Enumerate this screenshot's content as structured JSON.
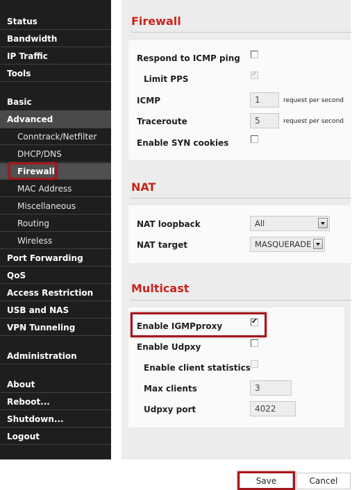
{
  "sidebar": {
    "items": [
      {
        "label": "Status"
      },
      {
        "label": "Bandwidth"
      },
      {
        "label": "IP Traffic"
      },
      {
        "label": "Tools"
      },
      {
        "label": "Basic"
      },
      {
        "label": "Advanced"
      },
      {
        "label": "Conntrack/Netfilter"
      },
      {
        "label": "DHCP/DNS"
      },
      {
        "label": "Firewall"
      },
      {
        "label": "MAC Address"
      },
      {
        "label": "Miscellaneous"
      },
      {
        "label": "Routing"
      },
      {
        "label": "Wireless"
      },
      {
        "label": "Port Forwarding"
      },
      {
        "label": "QoS"
      },
      {
        "label": "Access Restriction"
      },
      {
        "label": "USB and NAS"
      },
      {
        "label": "VPN Tunneling"
      },
      {
        "label": "Administration"
      },
      {
        "label": "About"
      },
      {
        "label": "Reboot..."
      },
      {
        "label": "Shutdown..."
      },
      {
        "label": "Logout"
      }
    ],
    "active_group": "Advanced",
    "active_item": "Firewall"
  },
  "firewall": {
    "title": "Firewall",
    "respond_icmp_label": "Respond to ICMP ping",
    "respond_icmp_checked": false,
    "limit_pps_label": "Limit PPS",
    "limit_pps_checked": true,
    "limit_pps_disabled": true,
    "icmp_label": "ICMP",
    "icmp_value": "1",
    "icmp_unit": "request per second",
    "traceroute_label": "Traceroute",
    "traceroute_value": "5",
    "traceroute_unit": "request per second",
    "syn_cookies_label": "Enable SYN cookies",
    "syn_cookies_checked": false
  },
  "nat": {
    "title": "NAT",
    "loopback_label": "NAT loopback",
    "loopback_value": "All",
    "target_label": "NAT target",
    "target_value": "MASQUERADE"
  },
  "multicast": {
    "title": "Multicast",
    "igmpproxy_label": "Enable IGMPproxy",
    "igmpproxy_checked": true,
    "udpxy_label": "Enable Udpxy",
    "udpxy_checked": false,
    "client_stats_label": "Enable client statistics",
    "client_stats_checked": false,
    "max_clients_label": "Max clients",
    "max_clients_value": "3",
    "udpxy_port_label": "Udpxy port",
    "udpxy_port_value": "4022"
  },
  "buttons": {
    "save": "Save",
    "cancel": "Cancel"
  },
  "colors": {
    "section_title": "#c8241a",
    "highlight_box": "#a5161b",
    "sidebar_bg": "#1e1e1e"
  },
  "icons": {
    "checkmark": "✔",
    "dropdown_arrow": "▼"
  }
}
